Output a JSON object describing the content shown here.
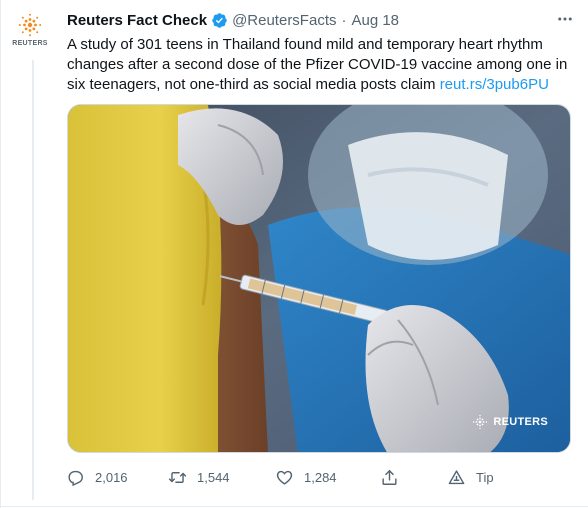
{
  "tweet": {
    "author_name": "Reuters Fact Check",
    "handle": "@ReutersFacts",
    "separator": "·",
    "date": "Aug 18",
    "avatar_wordmark": "REUTERS",
    "text_lines": [
      "A study of 301 teens in Thailand found mild and temporary heart rhythm",
      "changes after a second dose of the Pfizer COVID-19 vaccine among one in",
      "six teenagers, not one-third as social media posts claim "
    ],
    "link_text": "reut.rs/3pub6PU",
    "media_watermark": "REUTERS",
    "icons": {
      "verified": "verified-badge-icon",
      "more": "more-options-icon",
      "reply": "reply-icon",
      "retweet": "retweet-icon",
      "like": "heart-icon",
      "share": "share-icon",
      "tip": "tip-icon"
    }
  },
  "actions": {
    "reply_count": "2,016",
    "retweet_count": "1,544",
    "like_count": "1,284",
    "tip_label": "Tip"
  },
  "colors": {
    "link": "#1d9bf0",
    "verified": "#1d9bf0",
    "secondary_text": "#536471",
    "reuters_orange": "#f28b1e"
  }
}
